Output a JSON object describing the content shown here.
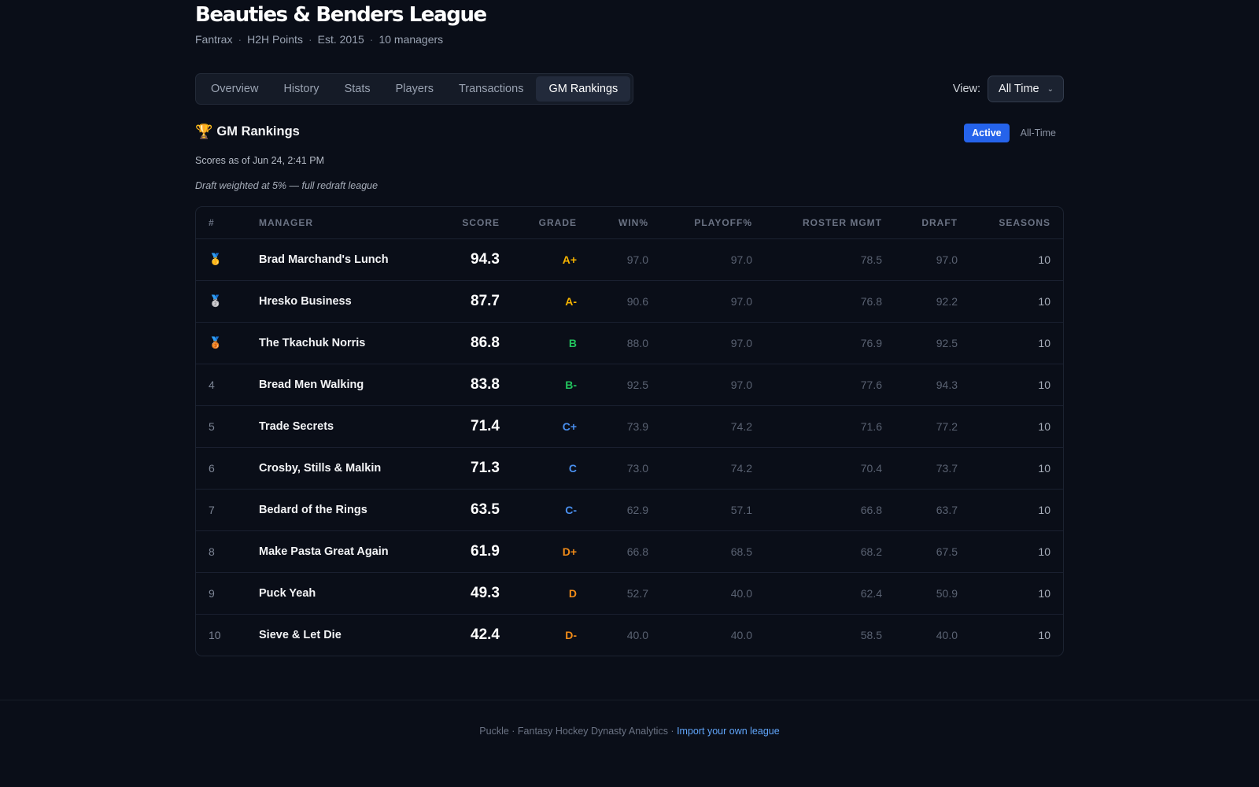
{
  "league": {
    "title": "Beauties & Benders League",
    "meta": [
      "Fantrax",
      "H2H Points",
      "Est. 2015",
      "10 managers"
    ]
  },
  "tabs": [
    {
      "label": "Overview",
      "active": false
    },
    {
      "label": "History",
      "active": false
    },
    {
      "label": "Stats",
      "active": false
    },
    {
      "label": "Players",
      "active": false
    },
    {
      "label": "Transactions",
      "active": false
    },
    {
      "label": "GM Rankings",
      "active": true
    }
  ],
  "view": {
    "label": "View:",
    "selected": "All Time"
  },
  "section": {
    "icon": "trophy-icon",
    "title": "GM Rankings",
    "toggle": [
      {
        "label": "Active",
        "active": true
      },
      {
        "label": "All-Time",
        "active": false
      }
    ],
    "scores_as_of": "Scores as of Jun 24, 2:41 PM",
    "draft_note": "Draft weighted at 5% — full redraft league"
  },
  "table": {
    "headers": [
      "#",
      "Manager",
      "Score",
      "Grade",
      "Win%",
      "Playoff%",
      "Roster Mgmt",
      "Draft",
      "Seasons"
    ],
    "rows": [
      {
        "rank": "1",
        "medal": "gold",
        "manager": "Brad Marchand's Lunch",
        "score": "94.3",
        "grade": "A+",
        "grade_color": "#f5b301",
        "win": "97.0",
        "playoff": "97.0",
        "roster": "78.5",
        "draft": "97.0",
        "seasons": "10"
      },
      {
        "rank": "2",
        "medal": "silver",
        "manager": "Hresko Business",
        "score": "87.7",
        "grade": "A-",
        "grade_color": "#f5b301",
        "win": "90.6",
        "playoff": "97.0",
        "roster": "76.8",
        "draft": "92.2",
        "seasons": "10"
      },
      {
        "rank": "3",
        "medal": "bronze",
        "manager": "The Tkachuk Norris",
        "score": "86.8",
        "grade": "B",
        "grade_color": "#22c55e",
        "win": "88.0",
        "playoff": "97.0",
        "roster": "76.9",
        "draft": "92.5",
        "seasons": "10"
      },
      {
        "rank": "4",
        "medal": null,
        "manager": "Bread Men Walking",
        "score": "83.8",
        "grade": "B-",
        "grade_color": "#22c55e",
        "win": "92.5",
        "playoff": "97.0",
        "roster": "77.6",
        "draft": "94.3",
        "seasons": "10"
      },
      {
        "rank": "5",
        "medal": null,
        "manager": "Trade Secrets",
        "score": "71.4",
        "grade": "C+",
        "grade_color": "#4a90f0",
        "win": "73.9",
        "playoff": "74.2",
        "roster": "71.6",
        "draft": "77.2",
        "seasons": "10"
      },
      {
        "rank": "6",
        "medal": null,
        "manager": "Crosby, Stills & Malkin",
        "score": "71.3",
        "grade": "C",
        "grade_color": "#4a90f0",
        "win": "73.0",
        "playoff": "74.2",
        "roster": "70.4",
        "draft": "73.7",
        "seasons": "10"
      },
      {
        "rank": "7",
        "medal": null,
        "manager": "Bedard of the Rings",
        "score": "63.5",
        "grade": "C-",
        "grade_color": "#4a90f0",
        "win": "62.9",
        "playoff": "57.1",
        "roster": "66.8",
        "draft": "63.7",
        "seasons": "10"
      },
      {
        "rank": "8",
        "medal": null,
        "manager": "Make Pasta Great Again",
        "score": "61.9",
        "grade": "D+",
        "grade_color": "#f28c18",
        "win": "66.8",
        "playoff": "68.5",
        "roster": "68.2",
        "draft": "67.5",
        "seasons": "10"
      },
      {
        "rank": "9",
        "medal": null,
        "manager": "Puck Yeah",
        "score": "49.3",
        "grade": "D",
        "grade_color": "#f28c18",
        "win": "52.7",
        "playoff": "40.0",
        "roster": "62.4",
        "draft": "50.9",
        "seasons": "10"
      },
      {
        "rank": "10",
        "medal": null,
        "manager": "Sieve & Let Die",
        "score": "42.4",
        "grade": "D-",
        "grade_color": "#f28c18",
        "win": "40.0",
        "playoff": "40.0",
        "roster": "58.5",
        "draft": "40.0",
        "seasons": "10"
      }
    ]
  },
  "footer": {
    "text": "Puckle · Fantasy Hockey Dynasty Analytics · ",
    "link": "Import your own league"
  }
}
